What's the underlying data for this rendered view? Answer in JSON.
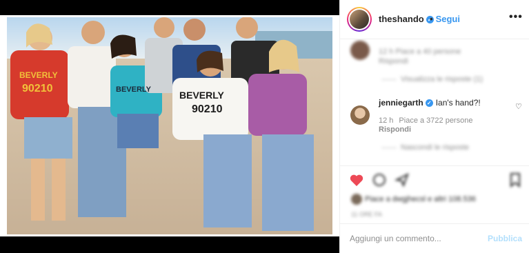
{
  "post": {
    "username": "theshando",
    "follow_label": "Segui",
    "more_label": "•••"
  },
  "comments": {
    "blurred_1": {
      "meta": "12 h   Piace a 40 persone",
      "reply": "Rispondi",
      "view": "Visualizza le risposte (1)"
    },
    "featured": {
      "username": "jenniegarth",
      "text": "Ian's hand?!",
      "time": "12 h",
      "likes": "Piace a 3722 persone",
      "reply": "Rispondi",
      "view_replies": "Nascondi le risposte"
    }
  },
  "actions": {
    "likes_text": "Piace a dwgjhecsl e altri 108.536",
    "date": "11 ORE FA"
  },
  "add_comment": {
    "placeholder": "Aggiungi un commento...",
    "publish_label": "Pubblica"
  },
  "colors": {
    "accent": "#3897f0",
    "heart": "#ed4956"
  },
  "icons": [
    "verified-icon",
    "more-icon",
    "heart-icon",
    "comment-icon",
    "share-icon",
    "bookmark-icon"
  ]
}
